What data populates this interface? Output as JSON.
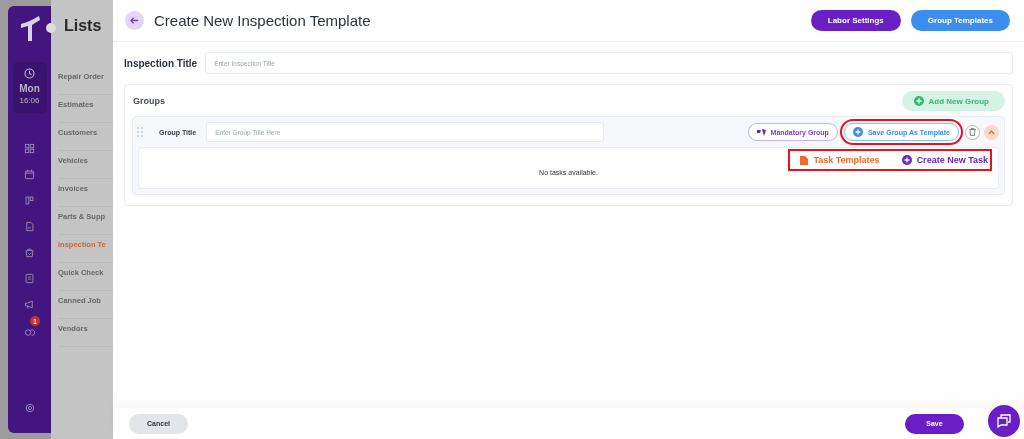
{
  "sidebar": {
    "day": "Mon",
    "time": "16:06",
    "notification_count": "1"
  },
  "lists_panel": {
    "title": "Lists",
    "items": [
      {
        "label": "Repair Order",
        "selected": false
      },
      {
        "label": "Estimates",
        "selected": false
      },
      {
        "label": "Customers",
        "selected": false
      },
      {
        "label": "Vehicles",
        "selected": false
      },
      {
        "label": "Invoices",
        "selected": false
      },
      {
        "label": "Parts & Supp",
        "selected": false
      },
      {
        "label": "Inspection Te",
        "selected": true
      },
      {
        "label": "Quick Check",
        "selected": false
      },
      {
        "label": "Canned Job",
        "selected": false
      },
      {
        "label": "Vendors",
        "selected": false
      }
    ]
  },
  "header": {
    "title": "Create New Inspection Template",
    "buttons": [
      {
        "label": "Labor Settings",
        "kind": "purple"
      },
      {
        "label": "Group Templates",
        "kind": "blue"
      }
    ]
  },
  "inspection_title": {
    "label": "Inspection Title",
    "placeholder": "Enter Inspection Title"
  },
  "groups": {
    "title": "Groups",
    "add_button": "Add New Group",
    "items": [
      {
        "label": "Group Title",
        "placeholder": "Enter Group Title Here",
        "mandatory_button": "Mandatory Group",
        "save_template_button": "Save Group As Template",
        "expanded": true,
        "task_templates_button": "Task Templates",
        "create_task_button": "Create New Task",
        "empty_message": "No tasks available."
      }
    ]
  },
  "footer": {
    "cancel": "Cancel",
    "save": "Save"
  }
}
